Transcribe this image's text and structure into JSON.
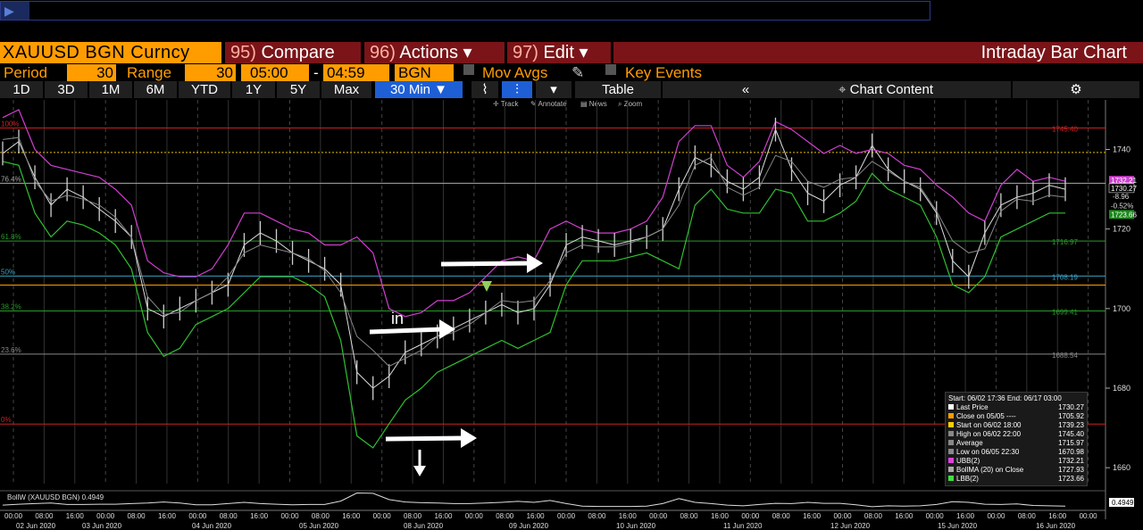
{
  "command_bar": {
    "arrow": "▶"
  },
  "header": {
    "ticker": "XAUUSD BGN Curncy",
    "compare_num": "95)",
    "compare": "Compare",
    "actions_num": "96)",
    "actions": "Actions ▾",
    "edit_num": "97)",
    "edit": "Edit ▾",
    "title": "Intraday Bar Chart"
  },
  "settings": {
    "period_label": "Period",
    "period_value": "30",
    "range_label": "Range",
    "range_value": "30",
    "start_time": "05:00",
    "sep": "-",
    "end_time": "04:59",
    "source": "BGN",
    "mov_avgs": "Mov Avgs",
    "key_events": "Key Events"
  },
  "toolbar": {
    "ranges": [
      "1D",
      "3D",
      "1M",
      "6M",
      "YTD",
      "1Y",
      "5Y",
      "Max"
    ],
    "interval": "30 Min ▼",
    "chart_icons": [
      "⌇",
      "⫶"
    ],
    "dropdown": "▾",
    "table": "Table",
    "collapse": "«",
    "chart_content": "Chart Content",
    "gear": "⚙"
  },
  "chart_tools": {
    "track": "Track",
    "annotate": "Annotate",
    "news": "News",
    "zoom": "Zoom"
  },
  "annotations": {
    "in": "in"
  },
  "fib_levels": [
    {
      "label": "100%",
      "value": "1745.40",
      "color": "#d02020"
    },
    {
      "label": "76.4%",
      "value": "",
      "color": "#aaaaaa"
    },
    {
      "label": "61.8%",
      "value": "1716.97",
      "color": "#2a9a2a"
    },
    {
      "label": "50%",
      "value": "1708.19",
      "color": "#3aa0c0"
    },
    {
      "label": "38.2%",
      "value": "1699.41",
      "color": "#2a9a2a"
    },
    {
      "label": "23.6%",
      "value": "1688.54",
      "color": "#888888"
    },
    {
      "label": "0%",
      "value": "",
      "color": "#d02020"
    }
  ],
  "y_axis": {
    "ticks": [
      "1740",
      "1720",
      "1700",
      "1680",
      "1660"
    ],
    "last_price": "1730.27",
    "change": "-8.96",
    "change_pct": "-0.52%",
    "ubb": "1732.21",
    "ma": "1727.93",
    "lbb": "1723.66",
    "avg": "1715.97",
    "sub_val": "0.4949"
  },
  "legend": {
    "header": "Start: 06/02 17:36 End: 06/17 03:00",
    "rows": [
      {
        "label": "Last Price",
        "value": "1730.27",
        "color": "#ffffff"
      },
      {
        "label": "Close on 05/05 ----",
        "value": "1705.92",
        "color": "#ff9c00"
      },
      {
        "label": "Start on 06/02 18:00",
        "value": "1739.23",
        "color": "#ffcc00"
      },
      {
        "label": "High on 06/02 22:00",
        "value": "1745.40",
        "color": "#888888"
      },
      {
        "label": "Average",
        "value": "1715.97",
        "color": "#888888"
      },
      {
        "label": "Low on 06/05 22:30",
        "value": "1670.98",
        "color": "#888888"
      },
      {
        "label": "UBB(2)",
        "value": "1732.21",
        "color": "#e040e0"
      },
      {
        "label": "BollMA (20) on Close",
        "value": "1727.93",
        "color": "#aaaaaa"
      },
      {
        "label": "LBB(2)",
        "value": "1723.66",
        "color": "#40e040"
      }
    ]
  },
  "subpanel": {
    "label": "BollW (XAUUSD BGN) 0.4949"
  },
  "x_axis": {
    "times": [
      "00:00",
      "08:00",
      "16:00",
      "00:00",
      "08:00",
      "16:00",
      "00:00",
      "08:00",
      "16:00",
      "00:00",
      "08:00",
      "16:00",
      "00:00",
      "08:00",
      "16:00",
      "00:00",
      "08:00",
      "16:00",
      "00:00",
      "08:00",
      "16:00",
      "00:00",
      "08:00",
      "16:00",
      "00:00",
      "08:00",
      "16:00",
      "00:00",
      "08:00",
      "16:00",
      "00:00",
      "16:00",
      "00:00",
      "08:00",
      "16:00",
      "00:00"
    ],
    "dates": [
      "02 Jun 2020",
      "03 Jun 2020",
      "04 Jun 2020",
      "05 Jun 2020",
      "08 Jun 2020",
      "09 Jun 2020",
      "10 Jun 2020",
      "11 Jun 2020",
      "12 Jun 2020",
      "15 Jun 2020",
      "16 Jun 2020"
    ]
  },
  "chart_data": {
    "type": "line",
    "series": [
      {
        "name": "Last Price",
        "values": [
          1739,
          1742,
          1733,
          1726,
          1730,
          1728,
          1725,
          1722,
          1718,
          1700,
          1698,
          1700,
          1702,
          1704,
          1706,
          1716,
          1719,
          1717,
          1714,
          1712,
          1710,
          1706,
          1684,
          1680,
          1683,
          1689,
          1691,
          1693,
          1695,
          1697,
          1699,
          1701,
          1699,
          1700,
          1706,
          1716,
          1718,
          1717,
          1716,
          1717,
          1718,
          1720,
          1730,
          1738,
          1736,
          1732,
          1730,
          1733,
          1745,
          1735,
          1729,
          1727,
          1731,
          1733,
          1741,
          1735,
          1732,
          1730,
          1724,
          1712,
          1708,
          1719,
          1726,
          1728,
          1729,
          1731,
          1730
        ]
      },
      {
        "name": "UBB(2)",
        "values": [
          1748,
          1750,
          1740,
          1736,
          1735,
          1734,
          1733,
          1730,
          1726,
          1712,
          1709,
          1708,
          1708,
          1710,
          1716,
          1724,
          1724,
          1722,
          1720,
          1719,
          1716,
          1716,
          1718,
          1714,
          1700,
          1698,
          1699,
          1702,
          1702,
          1704,
          1708,
          1712,
          1713,
          1712,
          1720,
          1722,
          1720,
          1719,
          1719,
          1720,
          1722,
          1728,
          1742,
          1746,
          1746,
          1736,
          1733,
          1737,
          1747,
          1745,
          1742,
          1739,
          1741,
          1739,
          1740,
          1739,
          1736,
          1735,
          1731,
          1728,
          1724,
          1722,
          1731,
          1735,
          1732,
          1733,
          1732
        ]
      },
      {
        "name": "LBB(2)",
        "values": [
          1737,
          1736,
          1724,
          1718,
          1722,
          1721,
          1719,
          1716,
          1710,
          1694,
          1688,
          1690,
          1696,
          1698,
          1700,
          1704,
          1708,
          1708,
          1708,
          1706,
          1703,
          1692,
          1668,
          1665,
          1671,
          1677,
          1680,
          1684,
          1686,
          1688,
          1690,
          1692,
          1690,
          1692,
          1694,
          1706,
          1712,
          1712,
          1712,
          1713,
          1714,
          1712,
          1710,
          1726,
          1730,
          1725,
          1724,
          1724,
          1730,
          1729,
          1722,
          1722,
          1724,
          1727,
          1734,
          1730,
          1728,
          1726,
          1718,
          1706,
          1704,
          1708,
          1718,
          1720,
          1722,
          1724,
          1724
        ]
      }
    ],
    "ylim": [
      1656,
      1752
    ]
  }
}
